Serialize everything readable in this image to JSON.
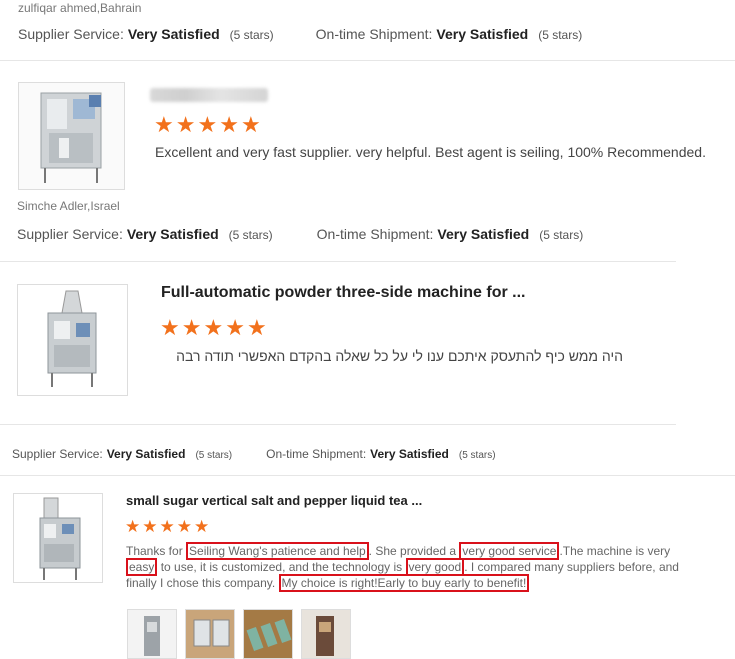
{
  "reviews": [
    {
      "reviewer": "zulfiqar ahmed,Bahrain",
      "supplier_service_label": "Supplier Service:",
      "supplier_service_value": "Very Satisfied",
      "supplier_service_stars": "(5 stars)",
      "shipment_label": "On-time Shipment:",
      "shipment_value": "Very Satisfied",
      "shipment_stars": "(5 stars)"
    },
    {
      "reviewer": "Simche Adler,Israel",
      "stars": 5,
      "text": "Excellent and very fast supplier. very helpful.  Best agent is seiling, 100% Recommended.",
      "supplier_service_label": "Supplier Service:",
      "supplier_service_value": "Very Satisfied",
      "supplier_service_stars": "(5 stars)",
      "shipment_label": "On-time Shipment:",
      "shipment_value": "Very Satisfied",
      "shipment_stars": "(5 stars)"
    },
    {
      "product_title": "Full-automatic powder three-side machine for ...",
      "stars": 5,
      "text": "היה ממש כיף להתעסק איתכם ענו לי על כל שאלה בהקדם האפשרי תודה רבה",
      "supplier_service_label": "Supplier Service:",
      "supplier_service_value": "Very Satisfied",
      "supplier_service_stars": "(5 stars)",
      "shipment_label": "On-time Shipment:",
      "shipment_value": "Very Satisfied",
      "shipment_stars": "(5 stars)"
    },
    {
      "product_title": "small sugar vertical salt and pepper liquid tea ...",
      "stars": 5,
      "text_parts": {
        "p1": "Thanks for ",
        "h1": "Seiling Wang's patience and help",
        "p2": ". She provided a ",
        "h2": "very good service",
        "p3": ".The machine is very ",
        "h3": "easy",
        "p4": " to use, it is customized, and the technology is ",
        "h4": "very good",
        "p5": ". I compared many suppliers before, and finally I chose this company. ",
        "h5": "My choice is right!Early to buy early to benefit!"
      }
    }
  ],
  "colors": {
    "star": "#f2711c",
    "highlight": "#d9111b"
  }
}
